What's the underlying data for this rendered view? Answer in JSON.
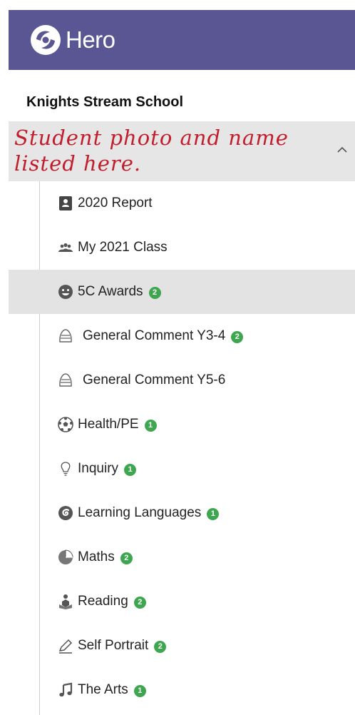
{
  "header": {
    "app_name": "Hero"
  },
  "school_name": "Knights Stream School",
  "student_row": {
    "annotation_line1": "Student photo and name",
    "annotation_line2": "listed here."
  },
  "nav_items": [
    {
      "label": "2020 Report",
      "icon": "report-book-icon",
      "badge": ""
    },
    {
      "label": "My 2021 Class",
      "icon": "class-group-icon",
      "badge": ""
    },
    {
      "label": "5C Awards",
      "icon": "smiley-face-icon",
      "badge": "2"
    },
    {
      "label": "General Comment Y3-4",
      "icon": "comment-shell-icon",
      "badge": "2"
    },
    {
      "label": "General Comment Y5-6",
      "icon": "comment-shell-icon",
      "badge": ""
    },
    {
      "label": "Health/PE",
      "icon": "soccer-ball-icon",
      "badge": "1"
    },
    {
      "label": "Inquiry",
      "icon": "lightbulb-icon",
      "badge": "1"
    },
    {
      "label": "Learning Languages",
      "icon": "spiral-icon",
      "badge": "1"
    },
    {
      "label": "Maths",
      "icon": "pie-chart-icon",
      "badge": "2"
    },
    {
      "label": "Reading",
      "icon": "reader-icon",
      "badge": "2"
    },
    {
      "label": "Self Portrait",
      "icon": "pencil-icon",
      "badge": "2"
    },
    {
      "label": "The Arts",
      "icon": "music-note-icon",
      "badge": "1"
    }
  ],
  "colors": {
    "header_bg": "#5a5693",
    "badge": "#3da64e",
    "annotation": "#c21d2c",
    "active_bg": "#e3e3e3"
  }
}
